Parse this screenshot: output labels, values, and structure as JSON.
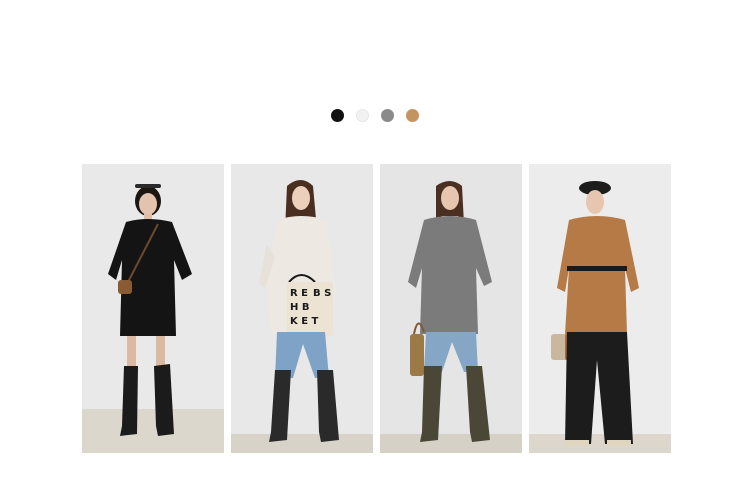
{
  "colors": {
    "accent": "#c49a6c"
  },
  "color_swatches": [
    {
      "name": "black",
      "hex": "#111111",
      "selected": true
    },
    {
      "name": "white",
      "hex": "#f2f2f2",
      "selected": false
    },
    {
      "name": "gray",
      "hex": "#8a8a8a",
      "selected": false
    },
    {
      "name": "camel",
      "hex": "#c4935f",
      "selected": false
    }
  ],
  "photos": [
    {
      "label": "model-black",
      "bg": "#e9e9e9",
      "floor": "#dcd7cd",
      "top": "#141414"
    },
    {
      "label": "model-white",
      "bg": "#e8e8e8",
      "floor": "#d8d3c9",
      "top": "#ede9e2"
    },
    {
      "label": "model-gray",
      "bg": "#e5e5e5",
      "floor": "#d6d1c7",
      "top": "#7b7b7b"
    },
    {
      "label": "model-camel",
      "bg": "#ececec",
      "floor": "#dcd6cc",
      "top": "#b57a45"
    }
  ],
  "bag_text": "RE BS HB KET"
}
